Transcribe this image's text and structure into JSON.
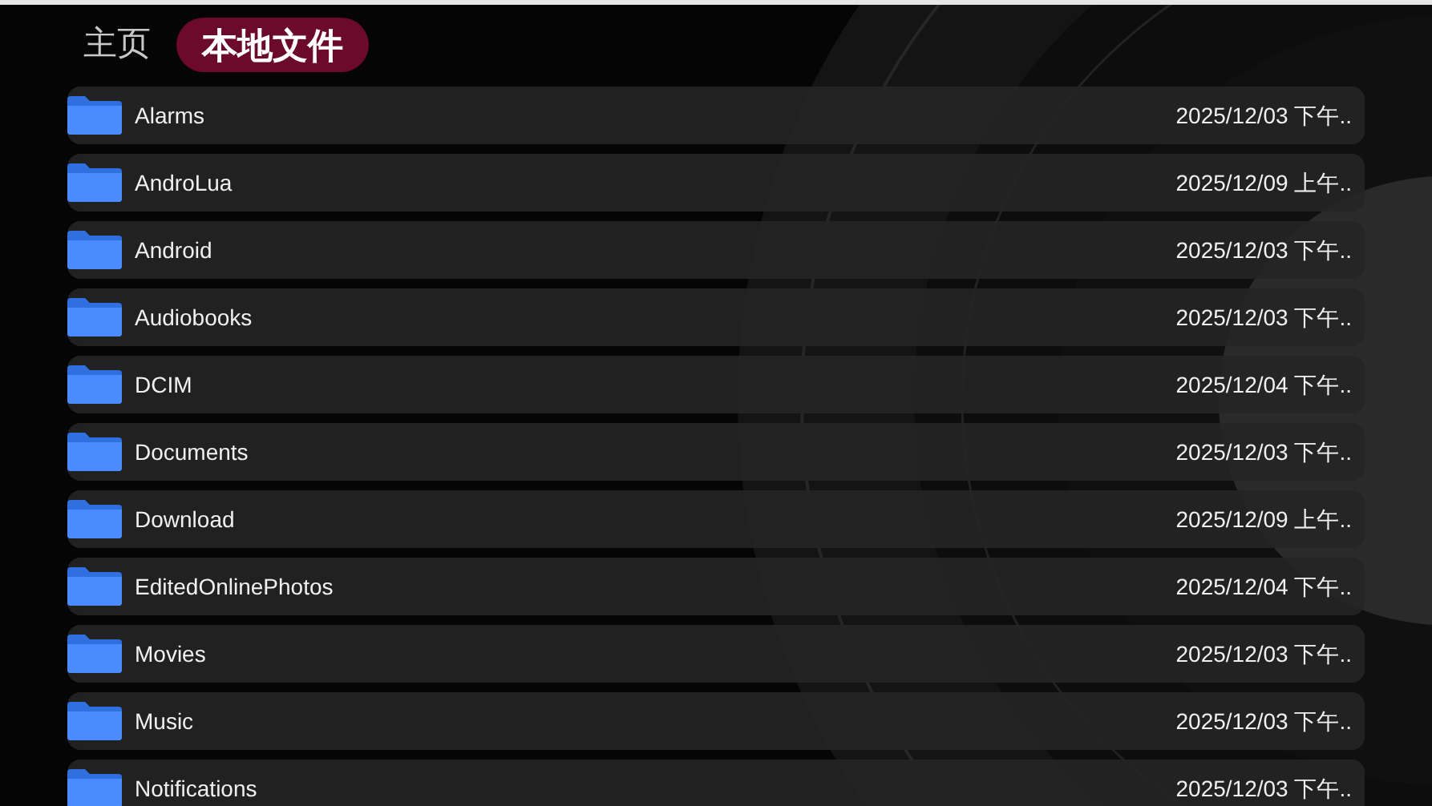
{
  "tabs": [
    {
      "label": "主页",
      "selected": false
    },
    {
      "label": "本地文件",
      "selected": true
    }
  ],
  "files": [
    {
      "name": "Alarms",
      "date": "2025/12/03 下午.."
    },
    {
      "name": "AndroLua",
      "date": "2025/12/09 上午.."
    },
    {
      "name": "Android",
      "date": "2025/12/03 下午.."
    },
    {
      "name": "Audiobooks",
      "date": "2025/12/03 下午.."
    },
    {
      "name": "DCIM",
      "date": "2025/12/04 下午.."
    },
    {
      "name": "Documents",
      "date": "2025/12/03 下午.."
    },
    {
      "name": "Download",
      "date": "2025/12/09 上午.."
    },
    {
      "name": "EditedOnlinePhotos",
      "date": "2025/12/04 下午.."
    },
    {
      "name": "Movies",
      "date": "2025/12/03 下午.."
    },
    {
      "name": "Music",
      "date": "2025/12/03 下午.."
    },
    {
      "name": "Notifications",
      "date": "2025/12/03 下午.."
    }
  ]
}
